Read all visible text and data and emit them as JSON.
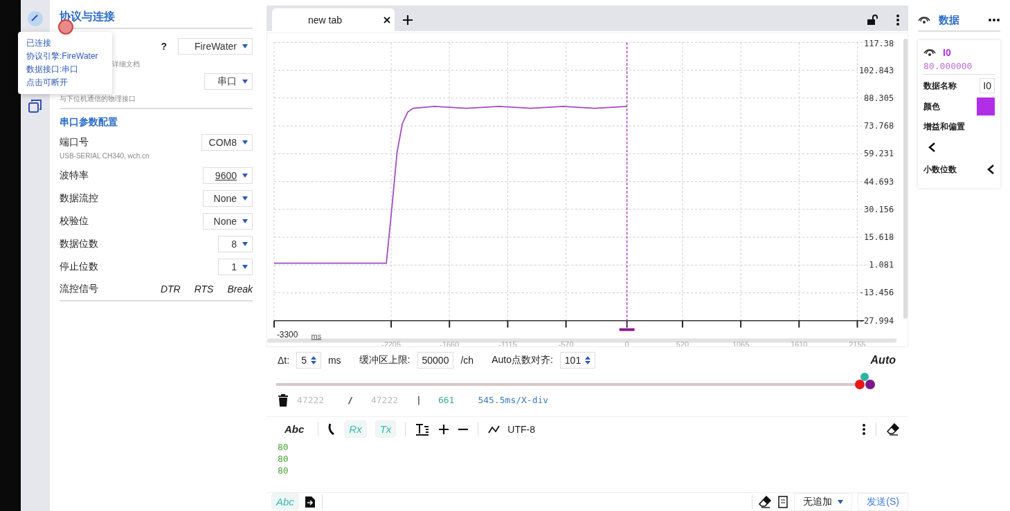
{
  "rail_tooltip": {
    "lines": [
      "已连接",
      "协议引擎:FireWater",
      "数据接口:串口",
      "点击可断开"
    ]
  },
  "settings": {
    "title": "协议与连接",
    "engine": {
      "help": "?",
      "value": "FireWater",
      "hint": "详细文档"
    },
    "interface": {
      "value": "串口",
      "hint": "与下位机通信的物理接口"
    },
    "section": "串口参数配置",
    "fields": [
      {
        "label": "端口号",
        "value": "COM8",
        "sub": "USB-SERIAL CH340, wch.cn",
        "underlined": false
      },
      {
        "label": "波特率",
        "value": "9600",
        "underlined": true
      },
      {
        "label": "数据流控",
        "value": "None",
        "underlined": false
      },
      {
        "label": "校验位",
        "value": "None",
        "underlined": false
      },
      {
        "label": "数据位数",
        "value": "8",
        "underlined": false
      },
      {
        "label": "停止位数",
        "value": "1",
        "underlined": false
      }
    ],
    "flow": {
      "label": "流控信号",
      "buttons": [
        "DTR",
        "RTS",
        "Break"
      ]
    }
  },
  "tabs": [
    {
      "label": "new tab",
      "selected": true
    }
  ],
  "chart": {
    "unit": "ms",
    "start_label": "-3300",
    "chart_data": {
      "type": "line",
      "grid": true,
      "xlim": [
        -3300,
        2155
      ],
      "ylim": [
        -27.994,
        117.38
      ],
      "ref_lines": [
        {
          "axis": "x",
          "value": 0,
          "color": "#a030b0"
        }
      ],
      "x": [
        -3300,
        -2300,
        -2250,
        -2200,
        -2150,
        -2100,
        -2050,
        -2000,
        -1800,
        -1500,
        -1200,
        -900,
        -600,
        -300,
        0
      ],
      "series": [
        {
          "name": "I0",
          "color": "#a24bc0",
          "values": [
            2,
            2,
            2,
            30,
            60,
            75,
            81,
            83,
            84,
            83,
            84,
            83,
            84,
            83,
            84
          ]
        }
      ],
      "xticks": [
        -2205,
        -1660,
        -1115,
        -570,
        0,
        520,
        1065,
        1610,
        2155
      ],
      "yticks": [
        117.38,
        102.843,
        88.305,
        73.768,
        59.231,
        44.693,
        30.156,
        15.618,
        1.081,
        -13.456,
        -27.994
      ]
    }
  },
  "controls": {
    "dt": {
      "label": "Δt:",
      "value": "5",
      "unit": "ms"
    },
    "buffer": {
      "label": "缓冲区上限:",
      "value": "50000",
      "unit": "/ch"
    },
    "align": {
      "label": "Auto点数对齐:",
      "value": "101"
    },
    "auto": "Auto",
    "level": 1
  },
  "stats": {
    "received": "47222",
    "slash": "/",
    "total": "47222",
    "bar": "|",
    "count": "661",
    "scale": "545.5ms/X-div"
  },
  "toolbar": {
    "abc": "Abc",
    "rx": {
      "label": "Rx",
      "on": true
    },
    "tx": {
      "label": "Tx",
      "on": true
    },
    "encoding": "UTF-8"
  },
  "log_lines": [
    "80",
    "80",
    "80"
  ],
  "send_bar": {
    "abc": "Abc",
    "append": "无追加",
    "send": "发送(S)"
  },
  "data_panel": {
    "title": "数据",
    "channel": {
      "value": "80.000000",
      "color": "#b12ee8",
      "name_label": "数据名称",
      "name_value": "I0",
      "color_label": "颜色",
      "gain_label": "增益和偏置",
      "decimals_label": "小数位数"
    }
  }
}
